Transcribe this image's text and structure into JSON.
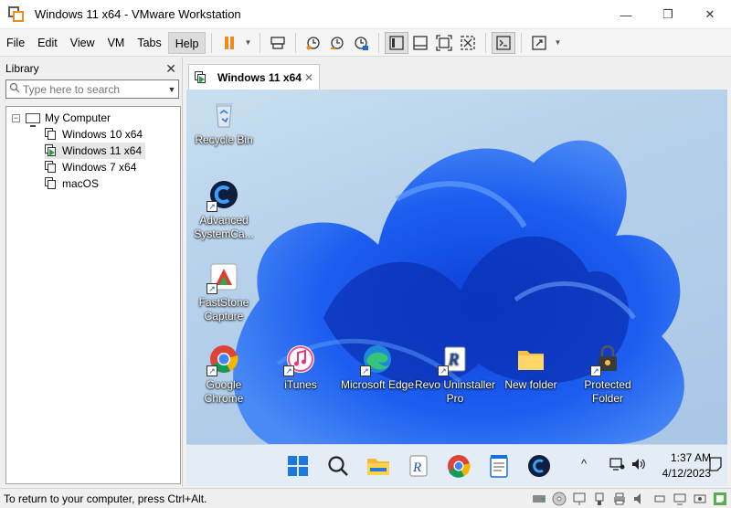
{
  "window": {
    "title": "Windows 11 x64 - VMware Workstation",
    "minimize_glyph": "—",
    "maximize_glyph": "❐",
    "close_glyph": "✕"
  },
  "menu": {
    "items": [
      "File",
      "Edit",
      "View",
      "VM",
      "Tabs",
      "Help"
    ],
    "active": "Help"
  },
  "toolbar": {
    "accent": "#f08a1c",
    "icons": [
      "pause-icon",
      "send-ctrl-alt-del-icon",
      "snapshot-icon",
      "revert-snapshot-icon",
      "snapshot-manager-icon",
      "show-library-icon",
      "thumbnail-bar-icon",
      "full-screen-icon",
      "unity-icon",
      "console-view-icon",
      "stretch-icon"
    ]
  },
  "library": {
    "title": "Library",
    "close_glyph": "✕",
    "search_placeholder": "Type here to search",
    "root_label": "My Computer",
    "vms": [
      {
        "label": "Windows 10 x64",
        "running": false
      },
      {
        "label": "Windows 11 x64",
        "running": true
      },
      {
        "label": "Windows 7 x64",
        "running": false
      },
      {
        "label": "macOS",
        "running": false
      }
    ]
  },
  "tab": {
    "label": "Windows 11 x64",
    "close_glyph": "✕"
  },
  "desktop": {
    "wallpaper_color": "#1b4fd8",
    "icons": [
      {
        "label": "Recycle Bin"
      },
      {
        "label": "Advanced SystemCa..."
      },
      {
        "label": "FastStone Capture"
      },
      {
        "label": "Google Chrome"
      },
      {
        "label": "iTunes"
      },
      {
        "label": "Microsoft Edge"
      },
      {
        "label": "Revo Uninstaller Pro"
      },
      {
        "label": "New folder"
      },
      {
        "label": "Protected Folder"
      }
    ]
  },
  "taskbar": {
    "apps": [
      "start-icon",
      "search-icon",
      "file-explorer-icon",
      "revo-uninstaller-icon",
      "chrome-icon",
      "notepad-icon",
      "advanced-systemcare-icon"
    ],
    "time": "1:37 AM",
    "date": "4/12/2023",
    "tray_chevron": "^"
  },
  "status": {
    "text": "To return to your computer, press Ctrl+Alt."
  }
}
